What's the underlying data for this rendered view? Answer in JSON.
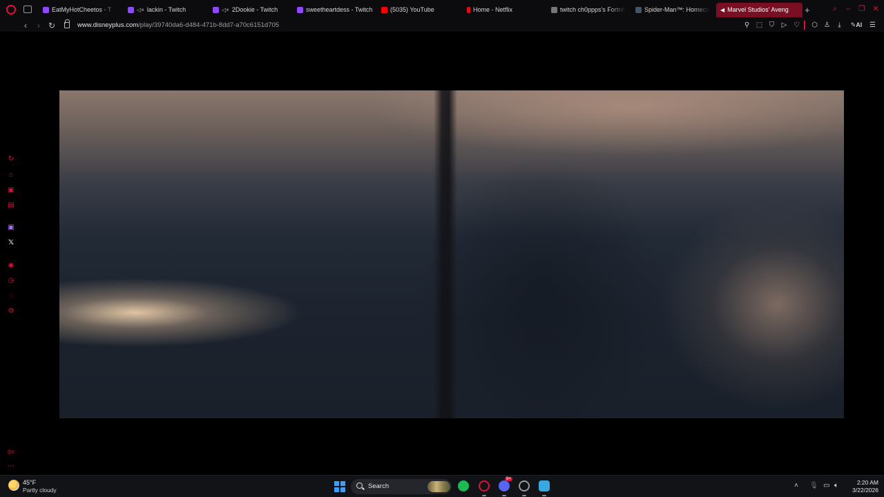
{
  "browser": {
    "accent_color": "#e0103a",
    "tabs": [
      {
        "label": "EatMyHotCheetos - T",
        "favicon": "twitch-icon",
        "muted": false,
        "active": false
      },
      {
        "label": "lackin - Twitch",
        "favicon": "twitch-icon",
        "muted": true,
        "active": false
      },
      {
        "label": "2Dookie - Twitch",
        "favicon": "twitch-icon",
        "muted": true,
        "active": false
      },
      {
        "label": "sweetheartdess - Twitch",
        "favicon": "twitch-icon",
        "muted": false,
        "active": false
      },
      {
        "label": "(5035) YouTube",
        "favicon": "youtube-icon",
        "muted": false,
        "active": false
      },
      {
        "label": "Home - Netflix",
        "favicon": "netflix-icon",
        "muted": false,
        "active": false
      },
      {
        "label": "twitch ch0ppps's Fortnit",
        "favicon": "page-icon",
        "muted": false,
        "active": false
      },
      {
        "label": "Spider-Man™: Homecom",
        "favicon": "page-icon",
        "muted": false,
        "active": false
      },
      {
        "label": "Marvel Studios' Aveng",
        "favicon": "speaker-icon",
        "muted": false,
        "active": true
      }
    ],
    "new_tab_symbol": "+",
    "address": {
      "host": "www.disneyplus.com",
      "path": "/play/39740da6-d484-471b-8dd7-a70c6151d705"
    },
    "ai_label": "AI"
  },
  "taskbar": {
    "weather": {
      "temp": "45°F",
      "desc": "Partly cloudy"
    },
    "search_label": "Search",
    "clock": {
      "time": "2:20 AM",
      "date": "3/22/2026"
    },
    "discord_badge": "9+"
  }
}
